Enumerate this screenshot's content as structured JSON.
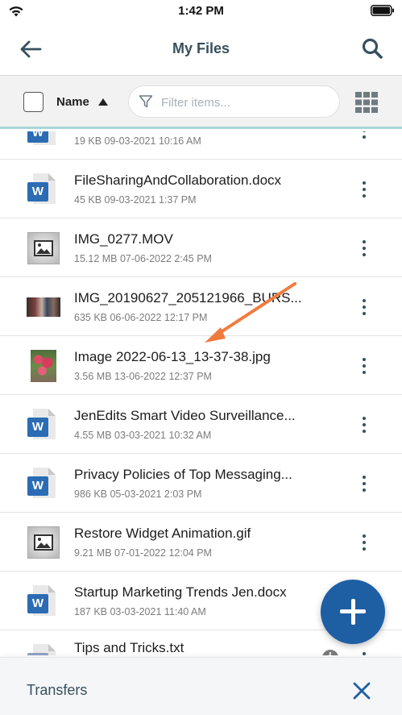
{
  "status_bar": {
    "time": "1:42 PM"
  },
  "header": {
    "title": "My Files"
  },
  "filter_bar": {
    "sort_label": "Name",
    "filter_placeholder": "Filter items..."
  },
  "files": [
    {
      "name": "",
      "meta": "19 KB 09-03-2021 10:16 AM",
      "icon": "word-document-icon"
    },
    {
      "name": "FileSharingAndCollaboration.docx",
      "meta": "45 KB 09-03-2021 1:37 PM",
      "icon": "word-document-icon"
    },
    {
      "name": "IMG_0277.MOV",
      "meta": "15.12 MB 07-06-2022 2:45 PM",
      "icon": "image-placeholder-icon"
    },
    {
      "name": "IMG_20190627_205121966_BURS...",
      "meta": "635 KB 06-06-2022 12:17 PM",
      "icon": "photo-thumbnail"
    },
    {
      "name": "Image 2022-06-13_13-37-38.jpg",
      "meta": "3.56 MB 13-06-2022 12:37 PM",
      "icon": "photo-thumbnail"
    },
    {
      "name": "JenEdits Smart Video Surveillance...",
      "meta": "4.55 MB 03-03-2021 10:32 AM",
      "icon": "word-document-icon"
    },
    {
      "name": "Privacy Policies of Top Messaging...",
      "meta": "986 KB 05-03-2021 2:03 PM",
      "icon": "word-document-icon"
    },
    {
      "name": "Restore Widget Animation.gif",
      "meta": "9.21 MB 07-01-2022 12:04 PM",
      "icon": "image-placeholder-icon"
    },
    {
      "name": "Startup Marketing Trends Jen.docx",
      "meta": "187 KB 03-03-2021 11:40 AM",
      "icon": "word-document-icon"
    },
    {
      "name": "Tips and Tricks.txt",
      "meta": "",
      "icon": "text-document-icon"
    }
  ],
  "transfers": {
    "label": "Transfers"
  },
  "colors": {
    "accent": "#1e5fa4",
    "title": "#37505e",
    "word_blue": "#2b6cb4",
    "annotation_arrow": "#f07b3f"
  }
}
